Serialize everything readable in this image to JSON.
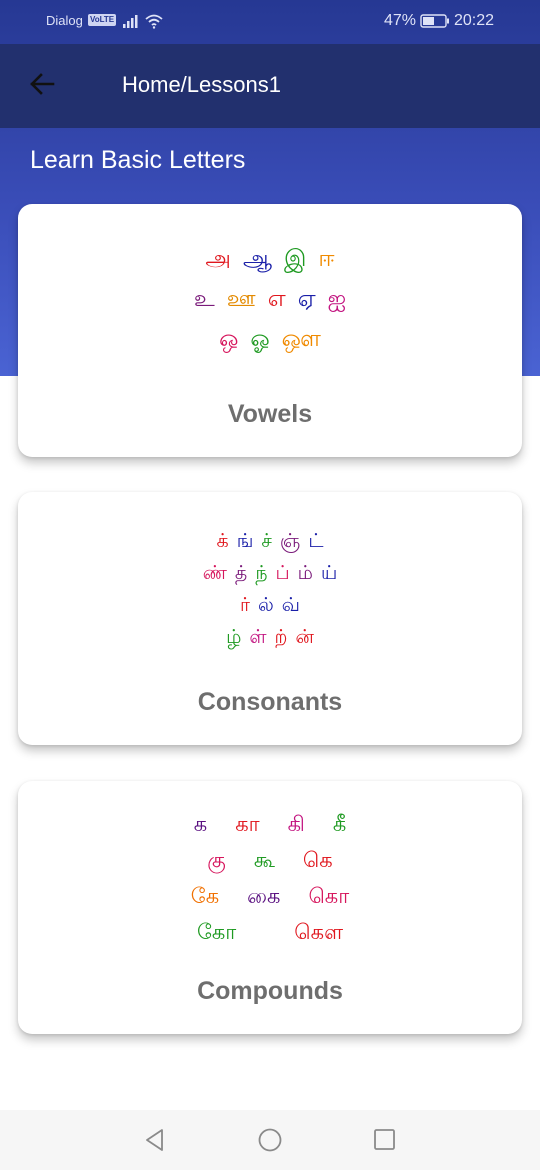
{
  "status_bar": {
    "carrier": "Dialog",
    "volte": "VoLTE",
    "battery_percent": "47%",
    "time": "20:22"
  },
  "app_bar": {
    "back_icon": "arrow-left-icon",
    "title": "Home/Lessons1"
  },
  "section": {
    "heading": "Learn Basic Letters"
  },
  "cards": {
    "vowels": {
      "label": "Vowels",
      "rows": [
        [
          {
            "text": "அ",
            "color": "#e0161d"
          },
          {
            "text": "ஆ",
            "color": "#1a1fa8"
          },
          {
            "text": "இ",
            "color": "#1f9a22"
          },
          {
            "text": "ஈ",
            "color": "#f08a00"
          }
        ],
        [
          {
            "text": "உ",
            "color": "#7a1a7a"
          },
          {
            "text": "ஊ",
            "color": "#e38a00"
          },
          {
            "text": "எ",
            "color": "#e0161d"
          },
          {
            "text": "ஏ",
            "color": "#1a1fa8"
          },
          {
            "text": "ஐ",
            "color": "#c2127f"
          }
        ],
        [
          {
            "text": "ஒ",
            "color": "#d6155c"
          },
          {
            "text": "ஓ",
            "color": "#1f9a22"
          },
          {
            "text": "ஔ",
            "color": "#f08a00"
          }
        ]
      ]
    },
    "consonants": {
      "label": "Consonants",
      "rows": [
        [
          {
            "text": "க்",
            "color": "#e0161d"
          },
          {
            "text": "ங்",
            "color": "#1a1fa8"
          },
          {
            "text": "ச்",
            "color": "#1f9a22"
          },
          {
            "text": "ஞ்",
            "color": "#7a1a7a"
          },
          {
            "text": "ட்",
            "color": "#1a1fa8"
          }
        ],
        [
          {
            "text": "ண்",
            "color": "#d6155c"
          },
          {
            "text": "த்",
            "color": "#7a1a7a"
          },
          {
            "text": "ந்",
            "color": "#1f9a22"
          },
          {
            "text": "ப்",
            "color": "#d6155c"
          },
          {
            "text": "ம்",
            "color": "#7a1a7a"
          },
          {
            "text": "ய்",
            "color": "#1a1fa8"
          }
        ],
        [
          {
            "text": "ர்",
            "color": "#e0161d"
          },
          {
            "text": "ல்",
            "color": "#1a1fa8"
          },
          {
            "text": "வ்",
            "color": "#1a1fa8"
          }
        ],
        [
          {
            "text": "ழ்",
            "color": "#1f9a22"
          },
          {
            "text": "ள்",
            "color": "#c2127f"
          },
          {
            "text": "ற்",
            "color": "#e0161d"
          },
          {
            "text": "ன்",
            "color": "#e0161d"
          }
        ]
      ]
    },
    "compounds": {
      "label": "Compounds",
      "rows": [
        [
          {
            "text": "க",
            "color": "#5a1080"
          },
          {
            "text": "கா",
            "color": "#e0161d"
          },
          {
            "text": "கி",
            "color": "#c2127f"
          },
          {
            "text": "கீ",
            "color": "#1f9a22"
          }
        ],
        [
          {
            "text": "கு",
            "color": "#d6155c"
          },
          {
            "text": "கூ",
            "color": "#1f9a22"
          },
          {
            "text": "கெ",
            "color": "#e0161d"
          }
        ],
        [
          {
            "text": "கே",
            "color": "#f07000"
          },
          {
            "text": "கை",
            "color": "#5a1080"
          },
          {
            "text": "கொ",
            "color": "#d6155c"
          }
        ],
        [
          {
            "text": "கோ",
            "color": "#1f9a22",
            "gap": true
          },
          {
            "text": "கௌ",
            "color": "#e0161d"
          }
        ]
      ]
    }
  },
  "nav_bar": {
    "back_icon": "triangle-back-icon",
    "home_icon": "circle-home-icon",
    "recents_icon": "square-recents-icon"
  }
}
